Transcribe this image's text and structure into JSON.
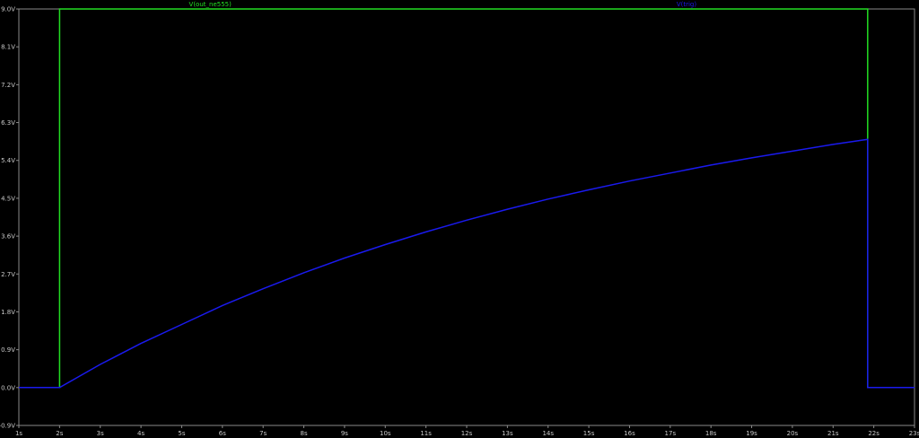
{
  "chart_data": {
    "type": "line",
    "background": "#000000",
    "grid": false,
    "xlim": [
      1,
      23
    ],
    "ylim": [
      -0.9,
      9.0
    ],
    "x_ticks": [
      "1s",
      "2s",
      "3s",
      "4s",
      "5s",
      "6s",
      "7s",
      "8s",
      "9s",
      "10s",
      "11s",
      "12s",
      "13s",
      "14s",
      "15s",
      "16s",
      "17s",
      "18s",
      "19s",
      "20s",
      "21s",
      "22s",
      "23s"
    ],
    "x_tick_values": [
      1,
      2,
      3,
      4,
      5,
      6,
      7,
      8,
      9,
      10,
      11,
      12,
      13,
      14,
      15,
      16,
      17,
      18,
      19,
      20,
      21,
      22,
      23
    ],
    "y_ticks": [
      "-0.9V",
      "0.0V",
      "0.9V",
      "1.8V",
      "2.7V",
      "3.6V",
      "4.5V",
      "5.4V",
      "6.3V",
      "7.2V",
      "8.1V",
      "9.0V"
    ],
    "y_tick_values": [
      -0.9,
      0.0,
      0.9,
      1.8,
      2.7,
      3.6,
      4.5,
      5.4,
      6.3,
      7.2,
      8.1,
      9.0
    ],
    "series": [
      {
        "name": "V(out_ne555)",
        "color": "#22dd22",
        "x": [
          1,
          2,
          2,
          21.85,
          21.85,
          23
        ],
        "y": [
          0,
          0,
          9.0,
          9.0,
          0,
          0
        ]
      },
      {
        "name": "V(trig)",
        "color": "#1a1aee",
        "x": [
          1,
          2,
          3,
          4,
          5,
          6,
          7,
          8,
          9,
          10,
          11,
          12,
          13,
          14,
          15,
          16,
          17,
          18,
          19,
          20,
          21,
          21.85,
          21.85,
          23
        ],
        "y": [
          0,
          0,
          0.55,
          1.05,
          1.5,
          1.95,
          2.35,
          2.73,
          3.08,
          3.4,
          3.7,
          3.98,
          4.24,
          4.48,
          4.7,
          4.91,
          5.1,
          5.29,
          5.46,
          5.62,
          5.78,
          5.9,
          0,
          0
        ]
      }
    ]
  }
}
